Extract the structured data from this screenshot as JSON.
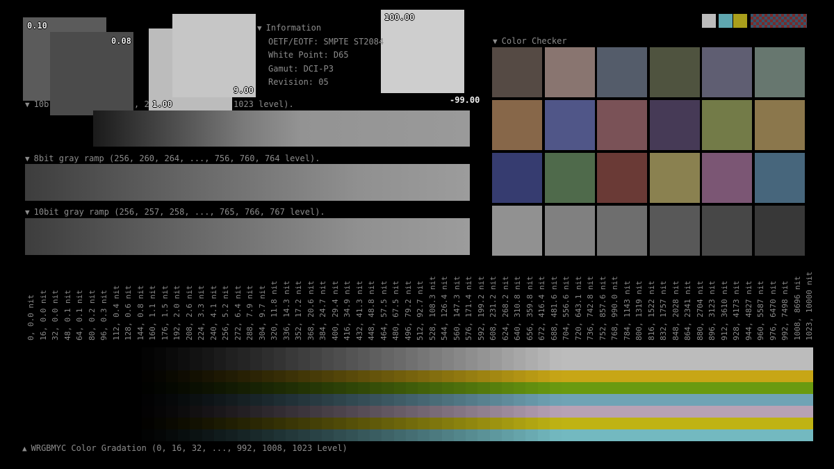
{
  "boxes": [
    {
      "label": "0.10",
      "color": "#5b5b5b"
    },
    {
      "label": "0.08",
      "color": "#4b4b4b"
    },
    {
      "label": "1.00",
      "color": "#bcbcbc"
    },
    {
      "label": "9.00",
      "color": "#c6c6c6"
    },
    {
      "label": "100.00",
      "color": "#cecece"
    },
    {
      "label": "-99.00"
    }
  ],
  "info": {
    "title": "Information",
    "lines": [
      "OETF/EOTF: SMPTE ST2084",
      "White Point: D65",
      "Gamut: DCI-P3",
      "Revision: 05"
    ]
  },
  "ramps": {
    "r1_prefix": "10b",
    "r1_mid": ", 2",
    "r1_suffix": "1023 level).",
    "r2": "8bit gray ramp (256, 260, 264, ..., 756, 760, 764 level).",
    "r3": "10bit gray ramp (256, 257, 258, ..., 765, 766, 767 level)."
  },
  "color_checker": {
    "title": "Color Checker",
    "colors": [
      "#554a44",
      "#897570",
      "#545c6a",
      "#4f533f",
      "#5f5e72",
      "#67776f",
      "#876749",
      "#505688",
      "#7a5257",
      "#463a56",
      "#737b48",
      "#8b774c",
      "#363c70",
      "#4f6a4b",
      "#6a3a36",
      "#8a8150",
      "#7b5674",
      "#47667c",
      "#919191",
      "#808080",
      "#6e6e6e",
      "#585858",
      "#474747",
      "#383838"
    ]
  },
  "nits": [
    {
      "code": "0",
      "nit": "0.0 nit"
    },
    {
      "code": "16",
      "nit": "0.0 nit"
    },
    {
      "code": "32",
      "nit": "0.0 nit"
    },
    {
      "code": "48",
      "nit": "0.1 nit"
    },
    {
      "code": "64",
      "nit": "0.1 nit"
    },
    {
      "code": "80",
      "nit": "0.2 nit"
    },
    {
      "code": "96",
      "nit": "0.3 nit"
    },
    {
      "code": "112",
      "nit": "0.4 nit"
    },
    {
      "code": "128",
      "nit": "0.6 nit"
    },
    {
      "code": "144",
      "nit": "0.8 nit"
    },
    {
      "code": "160",
      "nit": "1.1 nit"
    },
    {
      "code": "176",
      "nit": "1.5 nit"
    },
    {
      "code": "192",
      "nit": "2.0 nit"
    },
    {
      "code": "208",
      "nit": "2.6 nit"
    },
    {
      "code": "224",
      "nit": "3.3 nit"
    },
    {
      "code": "240",
      "nit": "4.1 nit"
    },
    {
      "code": "256",
      "nit": "5.2 nit"
    },
    {
      "code": "272",
      "nit": "6.4 nit"
    },
    {
      "code": "288",
      "nit": "7.9 nit"
    },
    {
      "code": "304",
      "nit": "9.7 nit"
    },
    {
      "code": "320",
      "nit": "11.8 nit"
    },
    {
      "code": "336",
      "nit": "14.3 nit"
    },
    {
      "code": "352",
      "nit": "17.2 nit"
    },
    {
      "code": "368",
      "nit": "20.6 nit"
    },
    {
      "code": "384",
      "nit": "24.7 nit"
    },
    {
      "code": "400",
      "nit": "29.4 nit"
    },
    {
      "code": "416",
      "nit": "34.9 nit"
    },
    {
      "code": "432",
      "nit": "41.3 nit"
    },
    {
      "code": "448",
      "nit": "48.8 nit"
    },
    {
      "code": "464",
      "nit": "57.5 nit"
    },
    {
      "code": "480",
      "nit": "67.5 nit"
    },
    {
      "code": "496",
      "nit": "79.2 nit"
    },
    {
      "code": "512",
      "nit": "92.7 nit"
    },
    {
      "code": "528",
      "nit": "108.3 nit"
    },
    {
      "code": "544",
      "nit": "126.4 nit"
    },
    {
      "code": "560",
      "nit": "147.3 nit"
    },
    {
      "code": "576",
      "nit": "171.4 nit"
    },
    {
      "code": "592",
      "nit": "199.2 nit"
    },
    {
      "code": "608",
      "nit": "231.2 nit"
    },
    {
      "code": "624",
      "nit": "268.2 nit"
    },
    {
      "code": "640",
      "nit": "310.8 nit"
    },
    {
      "code": "656",
      "nit": "359.8 nit"
    },
    {
      "code": "672",
      "nit": "416.4 nit"
    },
    {
      "code": "688",
      "nit": "481.6 nit"
    },
    {
      "code": "704",
      "nit": "556.6 nit"
    },
    {
      "code": "720",
      "nit": "643.1 nit"
    },
    {
      "code": "736",
      "nit": "742.8 nit"
    },
    {
      "code": "752",
      "nit": "857.6 nit"
    },
    {
      "code": "768",
      "nit": "990.0 nit"
    },
    {
      "code": "784",
      "nit": "1143 nit"
    },
    {
      "code": "800",
      "nit": "1319 nit"
    },
    {
      "code": "816",
      "nit": "1522 nit"
    },
    {
      "code": "832",
      "nit": "1757 nit"
    },
    {
      "code": "848",
      "nit": "2028 nit"
    },
    {
      "code": "864",
      "nit": "2341 nit"
    },
    {
      "code": "880",
      "nit": "2704 nit"
    },
    {
      "code": "896",
      "nit": "3123 nit"
    },
    {
      "code": "912",
      "nit": "3610 nit"
    },
    {
      "code": "928",
      "nit": "4173 nit"
    },
    {
      "code": "944",
      "nit": "4827 nit"
    },
    {
      "code": "960",
      "nit": "5587 nit"
    },
    {
      "code": "976",
      "nit": "6470 nit"
    },
    {
      "code": "992",
      "nit": "7498 nit"
    },
    {
      "code": "1008",
      "nit": "8696 nit"
    },
    {
      "code": "1023",
      "nit": "10000 nit"
    }
  ],
  "gradation": {
    "label": "WRGBMYC Color Gradation (0, 16, 32, ..., 992, 1008, 1023 Level)",
    "rows": [
      {
        "name": "white",
        "color": "#bcbcbc"
      },
      {
        "name": "red",
        "color": "#c7a616"
      },
      {
        "name": "green",
        "color": "#6a9a10"
      },
      {
        "name": "blue",
        "color": "#6fa3b5"
      },
      {
        "name": "magenta",
        "color": "#b7a2b5"
      },
      {
        "name": "yellow",
        "color": "#bfb314"
      },
      {
        "name": "cyan",
        "color": "#73b9c0"
      }
    ]
  },
  "top_swatches": [
    "#bcbcbc",
    "#5fa7b0",
    "#a99f1c"
  ]
}
